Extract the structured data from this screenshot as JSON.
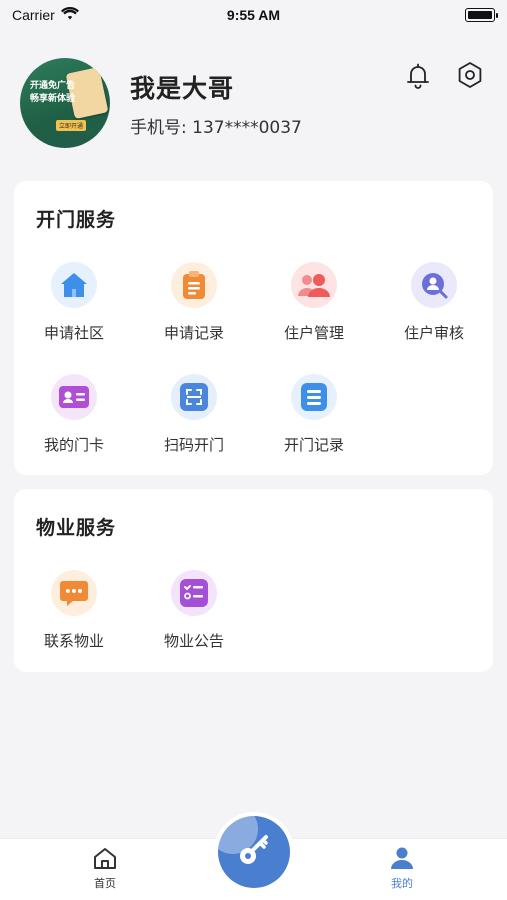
{
  "status_bar": {
    "carrier": "Carrier",
    "time": "9:55 AM"
  },
  "profile": {
    "name": "我是大哥",
    "phone": "手机号: 137****0037",
    "avatar_lines": [
      "开通免广告",
      "畅享新体验"
    ],
    "avatar_tag": "立即开通"
  },
  "door_service": {
    "title": "开门服务",
    "items": [
      {
        "label": "申请社区",
        "icon": "home-icon",
        "color": "#3d8fe8",
        "bg": "#e6f1fd"
      },
      {
        "label": "申请记录",
        "icon": "clipboard-icon",
        "color": "#f08a36",
        "bg": "#fdeede"
      },
      {
        "label": "住户管理",
        "icon": "users-icon",
        "color": "#ef5a5a",
        "bg": "#fde3e3"
      },
      {
        "label": "住户审核",
        "icon": "user-search-icon",
        "color": "#6c6fd8",
        "bg": "#e9e9fb"
      },
      {
        "label": "我的门卡",
        "icon": "id-card-icon",
        "color": "#b04fd6",
        "bg": "#f5e5fb"
      },
      {
        "label": "扫码开门",
        "icon": "scan-icon",
        "color": "#4a86dc",
        "bg": "#e5eefb"
      },
      {
        "label": "开门记录",
        "icon": "list-icon",
        "color": "#3d8fe8",
        "bg": "#e6f1fd"
      }
    ]
  },
  "property_service": {
    "title": "物业服务",
    "items": [
      {
        "label": "联系物业",
        "icon": "chat-icon",
        "color": "#f08a36",
        "bg": "#fdeede"
      },
      {
        "label": "物业公告",
        "icon": "checklist-icon",
        "color": "#a34fd6",
        "bg": "#f3e3fb"
      }
    ]
  },
  "tabbar": {
    "home_label": "首页",
    "mine_label": "我的",
    "active_color": "#4a7fd0",
    "inactive_color": "#333333"
  }
}
